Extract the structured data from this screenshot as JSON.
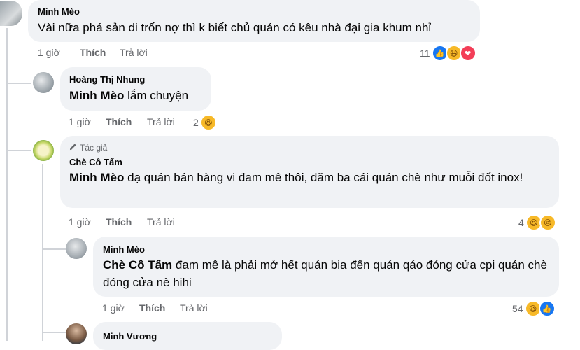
{
  "comments": [
    {
      "author": "Minh Mèo",
      "text": "Vài nữa phá sản di trốn nợ thì k biết chủ quán có kêu nhà đại gia khum nhỉ",
      "time": "1 giờ",
      "like_label": "Thích",
      "reply_label": "Trả lời",
      "reaction_count": "11",
      "reactions": [
        "like-icon",
        "haha-icon",
        "love-icon"
      ]
    },
    {
      "author": "Hoàng Thị Nhung",
      "mention": "Minh Mèo",
      "text": "lắm chuyện",
      "time": "1 giờ",
      "like_label": "Thích",
      "reply_label": "Trả lời",
      "reaction_count": "2",
      "reactions": [
        "haha-icon"
      ]
    },
    {
      "author_badge": "Tác giả",
      "author": "Chè Cô Tấm",
      "mention": "Minh Mèo",
      "text": "dạ quán bán hàng vi đam mê thôi, dăm ba cái quán chè như muỗi đốt inox!",
      "time": "1 giờ",
      "like_label": "Thích",
      "reply_label": "Trả lời",
      "reaction_count": "4",
      "reactions": [
        "haha-icon",
        "sad-icon"
      ]
    },
    {
      "author": "Minh Mèo",
      "mention": "Chè Cô Tấm",
      "text": "đam mê là phải mở hết quán bia đến quán qáo đóng cửa cpi quán chè đóng cửa nè hihi",
      "time": "1 giờ",
      "like_label": "Thích",
      "reply_label": "Trả lời",
      "reaction_count": "54",
      "reactions": [
        "haha-icon",
        "like-icon"
      ]
    },
    {
      "author": "Minh Vương"
    }
  ],
  "colors": {
    "bubble": "#f0f2f5",
    "meta": "#65676b",
    "like": "#1877f2",
    "haha": "#f7b928",
    "love": "#f33e58"
  }
}
